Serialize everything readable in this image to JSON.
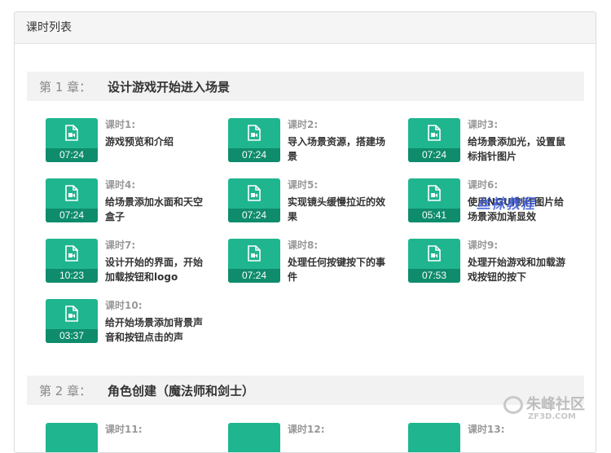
{
  "panel": {
    "title": "课时列表"
  },
  "chapters": [
    {
      "num": "第 1 章：",
      "title": "设计游戏开始进入场景"
    },
    {
      "num": "第 2 章：",
      "title": "角色创建（魔法师和剑士）"
    }
  ],
  "lessons": [
    {
      "num": "课时1:",
      "title": "游戏预览和介绍",
      "duration": "07:24"
    },
    {
      "num": "课时2:",
      "title": "导入场景资源，搭建场景",
      "duration": "07:24"
    },
    {
      "num": "课时3:",
      "title": "给场景添加光，设置鼠标指针图片",
      "duration": "07:24"
    },
    {
      "num": "课时4:",
      "title": "给场景添加水面和天空盒子",
      "duration": "07:24"
    },
    {
      "num": "课时5:",
      "title": "实现镜头缓慢拉近的效果",
      "duration": "07:24"
    },
    {
      "num": "课时6:",
      "title": "使用NGUI制作图片给场景添加渐显效",
      "duration": "05:41"
    },
    {
      "num": "课时7:",
      "title": "设计开始的界面，开始加载按钮和logo",
      "duration": "10:23"
    },
    {
      "num": "课时8:",
      "title": "处理任何按键按下的事件",
      "duration": "07:24"
    },
    {
      "num": "课时9:",
      "title": "处理开始游戏和加载游戏按钮的按下",
      "duration": "07:53"
    },
    {
      "num": "课时10:",
      "title": "给开始场景添加背景声音和按钮点击的声",
      "duration": "03:37"
    },
    {
      "num": "课时11:",
      "title": "",
      "duration": ""
    },
    {
      "num": "课时12:",
      "title": "",
      "duration": ""
    },
    {
      "num": "课时13:",
      "title": "",
      "duration": ""
    }
  ],
  "watermarks": {
    "tutorial": "丝袜教程",
    "brand": "朱峰社区",
    "brand_url": "ZF3D.COM"
  },
  "colors": {
    "thumb": "#1fb58f",
    "thumb_bar": "#0e8c6c",
    "chapter_bg": "#f2f2f2"
  },
  "icons": {
    "lesson_thumb": "video-file-icon"
  }
}
